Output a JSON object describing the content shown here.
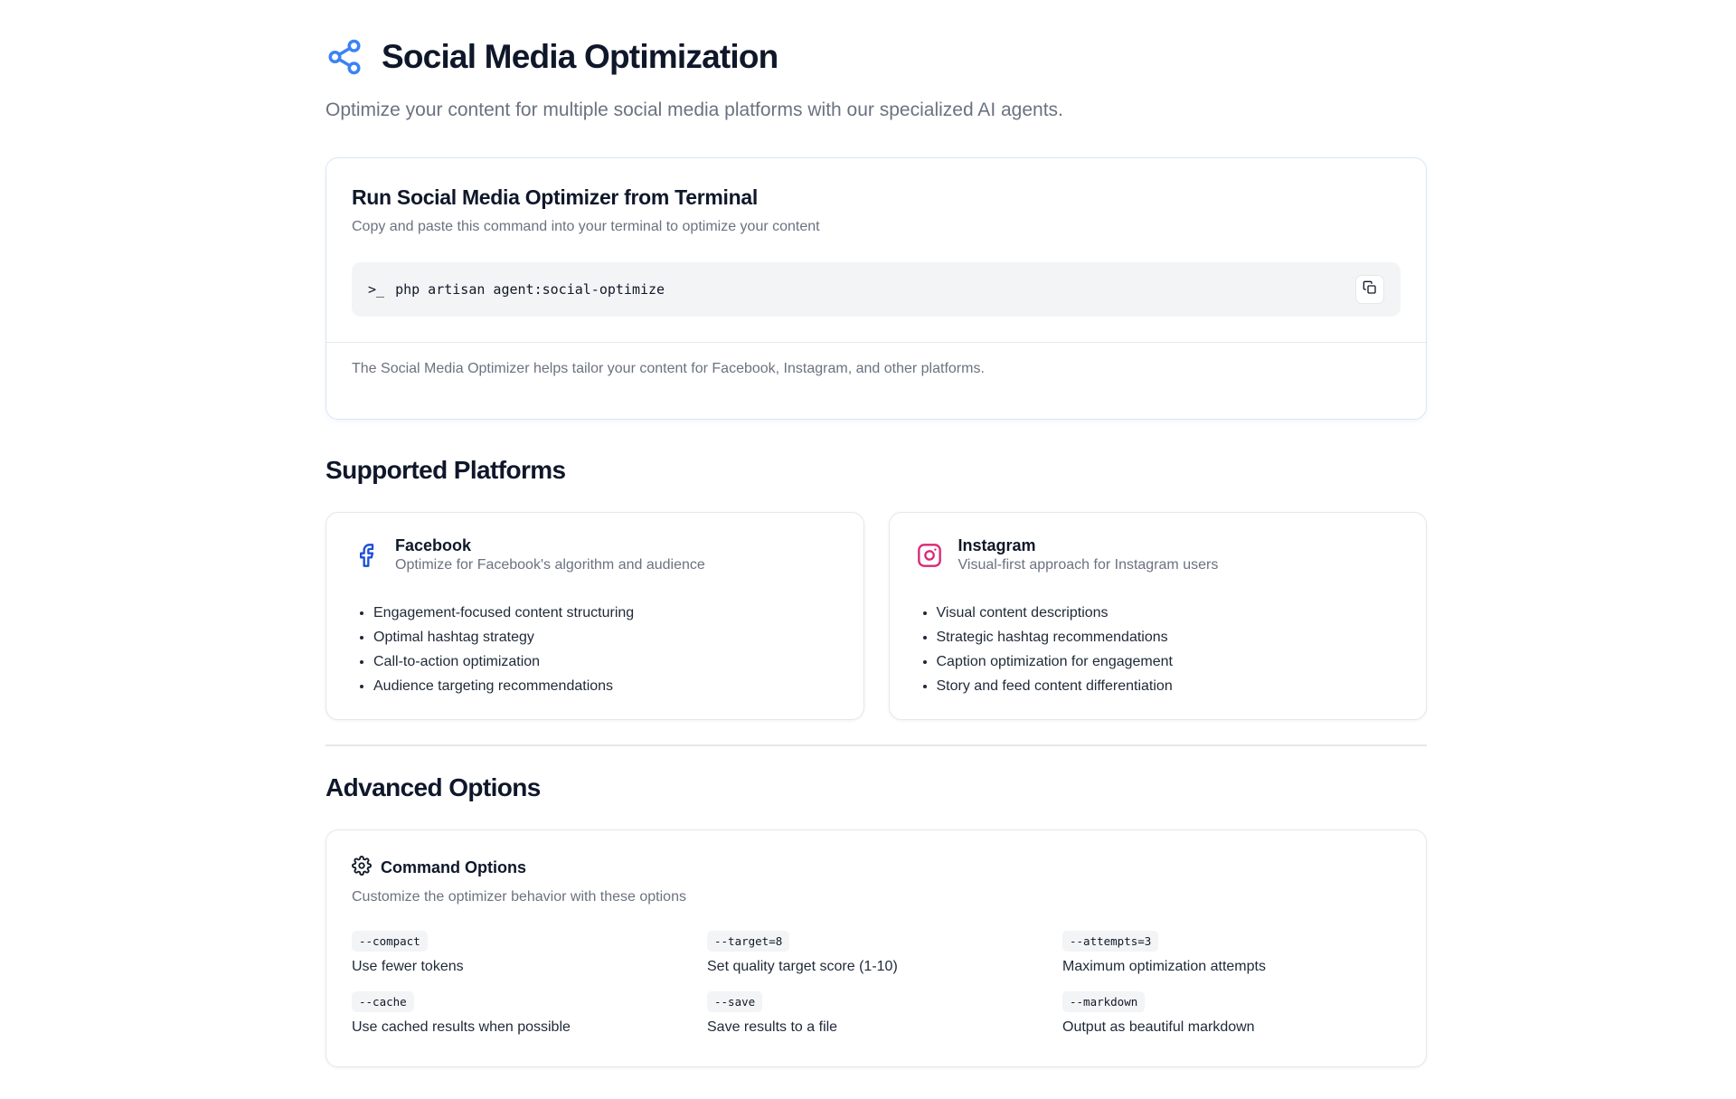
{
  "header": {
    "icon": "share-icon",
    "title": "Social Media Optimization",
    "subtitle": "Optimize your content for multiple social media platforms with our specialized AI agents.",
    "accent_color": "#3b82f6"
  },
  "terminal": {
    "title": "Run Social Media Optimizer from Terminal",
    "description": "Copy and paste this command into your terminal to optimize your content",
    "prompt": ">_",
    "command": "php artisan agent:social-optimize",
    "copy_icon": "copy-icon",
    "note": "The Social Media Optimizer helps tailor your content for Facebook, Instagram, and other platforms."
  },
  "platforms": {
    "title": "Supported Platforms",
    "items": [
      {
        "name": "Facebook",
        "icon": "facebook-icon",
        "color": "#1d4ed8",
        "description": "Optimize for Facebook's algorithm and audience",
        "features": [
          "Engagement-focused content structuring",
          "Optimal hashtag strategy",
          "Call-to-action optimization",
          "Audience targeting recommendations"
        ]
      },
      {
        "name": "Instagram",
        "icon": "instagram-icon",
        "color": "#db2777",
        "description": "Visual-first approach for Instagram users",
        "features": [
          "Visual content descriptions",
          "Strategic hashtag recommendations",
          "Caption optimization for engagement",
          "Story and feed content differentiation"
        ]
      }
    ]
  },
  "advanced": {
    "title": "Advanced Options",
    "card_title": "Command Options",
    "card_icon": "gear-icon",
    "card_description": "Customize the optimizer behavior with these options",
    "options": [
      {
        "flag": "--compact",
        "description": "Use fewer tokens"
      },
      {
        "flag": "--target=8",
        "description": "Set quality target score (1-10)"
      },
      {
        "flag": "--attempts=3",
        "description": "Maximum optimization attempts"
      },
      {
        "flag": "--cache",
        "description": "Use cached results when possible"
      },
      {
        "flag": "--save",
        "description": "Save results to a file"
      },
      {
        "flag": "--markdown",
        "description": "Output as beautiful markdown"
      }
    ]
  }
}
